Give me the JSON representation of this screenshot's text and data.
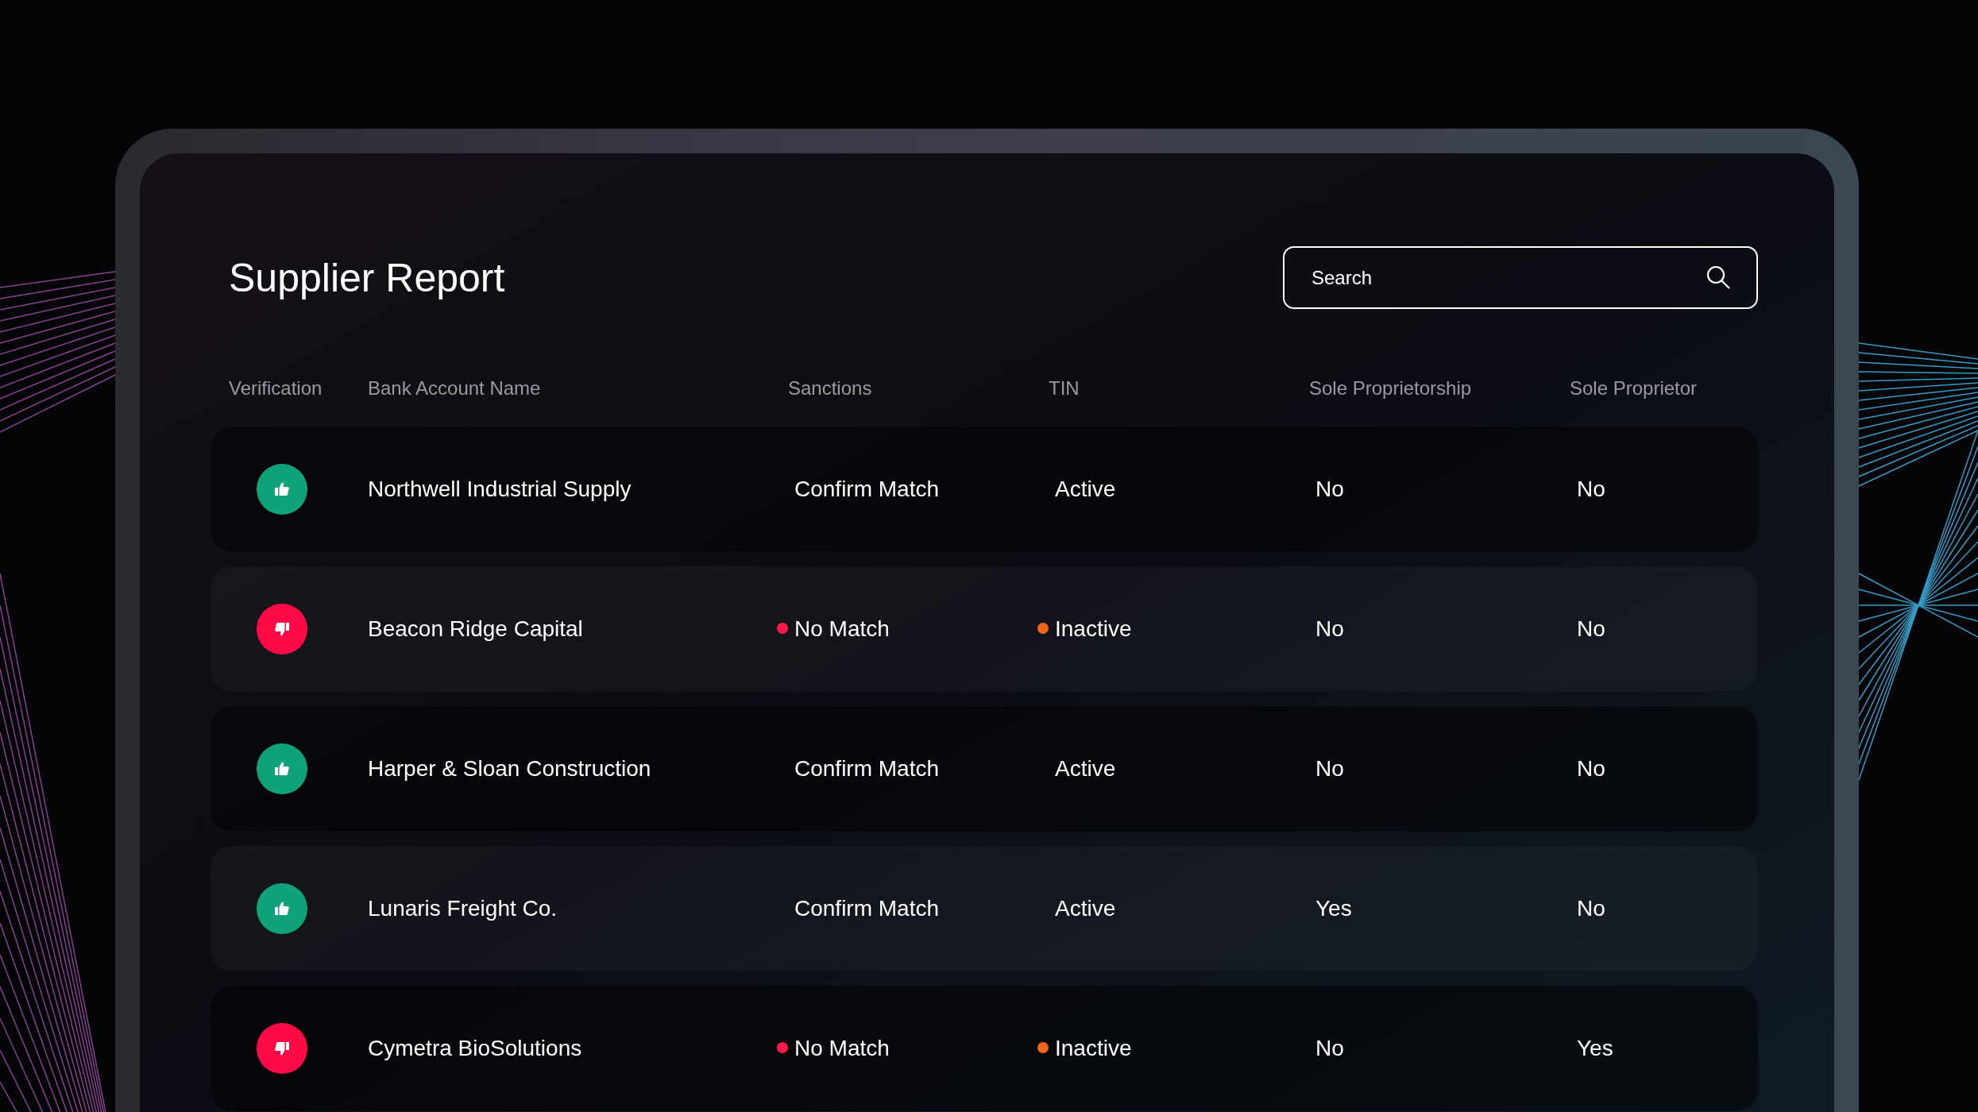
{
  "title": "Supplier Report",
  "search": {
    "placeholder": "Search"
  },
  "table": {
    "columns": [
      "Verification",
      "Bank Account Name",
      "Sanctions",
      "TIN",
      "Sole Proprietorship",
      "Sole Proprietor"
    ],
    "rows": [
      {
        "verified": true,
        "name": "Northwell Industrial Supply",
        "sanctions": {
          "text": "Confirm Match"
        },
        "tin": {
          "text": "Active"
        },
        "sole_proprietorship": "No",
        "sole_proprietor": "No"
      },
      {
        "verified": false,
        "name": "Beacon Ridge Capital",
        "sanctions": {
          "text": "No Match",
          "color": "#ff1a4b"
        },
        "tin": {
          "text": "Inactive",
          "color": "#f2661b"
        },
        "sole_proprietorship": "No",
        "sole_proprietor": "No"
      },
      {
        "verified": true,
        "name": "Harper & Sloan Construction",
        "sanctions": {
          "text": "Confirm Match"
        },
        "tin": {
          "text": "Active"
        },
        "sole_proprietorship": "No",
        "sole_proprietor": "No"
      },
      {
        "verified": true,
        "name": "Lunaris Freight Co.",
        "sanctions": {
          "text": "Confirm Match"
        },
        "tin": {
          "text": "Active"
        },
        "sole_proprietorship": "Yes",
        "sole_proprietor": "No"
      },
      {
        "verified": false,
        "name": "Cymetra BioSolutions",
        "sanctions": {
          "text": "No Match",
          "color": "#ff1a4b"
        },
        "tin": {
          "text": "Inactive",
          "color": "#f2661b"
        },
        "sole_proprietorship": "No",
        "sole_proprietor": "Yes"
      }
    ]
  }
}
